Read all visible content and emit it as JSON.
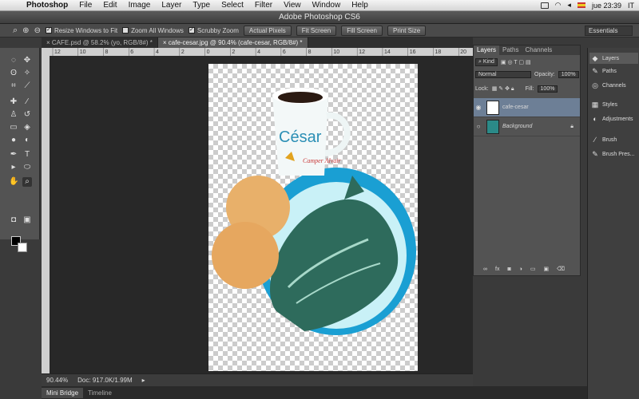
{
  "menubar": {
    "app": "Photoshop",
    "items": [
      "File",
      "Edit",
      "Image",
      "Layer",
      "Type",
      "Select",
      "Filter",
      "View",
      "Window",
      "Help"
    ],
    "clock": "jue 23:39",
    "lang": "IT"
  },
  "window": {
    "title": "Adobe Photoshop CS6"
  },
  "options": {
    "resize_windows": "Resize Windows to Fit",
    "zoom_all": "Zoom All Windows",
    "scrubby": "Scrubby Zoom",
    "actual_pixels": "Actual Pixels",
    "fit_screen": "Fit Screen",
    "fill_screen": "Fill Screen",
    "print_size": "Print Size",
    "workspace": "Essentials"
  },
  "tabs": [
    {
      "label": "CAFE.psd @ 58.2% (yo, RGB/8#) *"
    },
    {
      "label": "cafe-cesar.jpg @ 90.4% (cafe-cesar, RGB/8#) *"
    }
  ],
  "ruler": {
    "ticks": [
      "12",
      "10",
      "8",
      "6",
      "4",
      "2",
      "0",
      "2",
      "4",
      "6",
      "8",
      "10",
      "12",
      "14",
      "16",
      "18",
      "20"
    ]
  },
  "image": {
    "cup_text": "César",
    "logo_text": "Camper Alvair"
  },
  "status": {
    "zoom": "90.44%",
    "doc": "Doc: 917.0K/1.99M"
  },
  "bottom_tabs": [
    "Mini Bridge",
    "Timeline"
  ],
  "layers_panel": {
    "tabs": [
      "Layers",
      "Paths",
      "Channels"
    ],
    "kind": "Kind",
    "blend": "Normal",
    "opacity_label": "Opacity:",
    "opacity": "100%",
    "lock_label": "Lock:",
    "fill_label": "Fill:",
    "fill": "100%",
    "layers": [
      {
        "name": "cafe-cesar"
      },
      {
        "name": "Background"
      }
    ]
  },
  "dock": [
    "Layers",
    "Paths",
    "Channels",
    "Styles",
    "Adjustments",
    "Brush",
    "Brush Pres..."
  ]
}
